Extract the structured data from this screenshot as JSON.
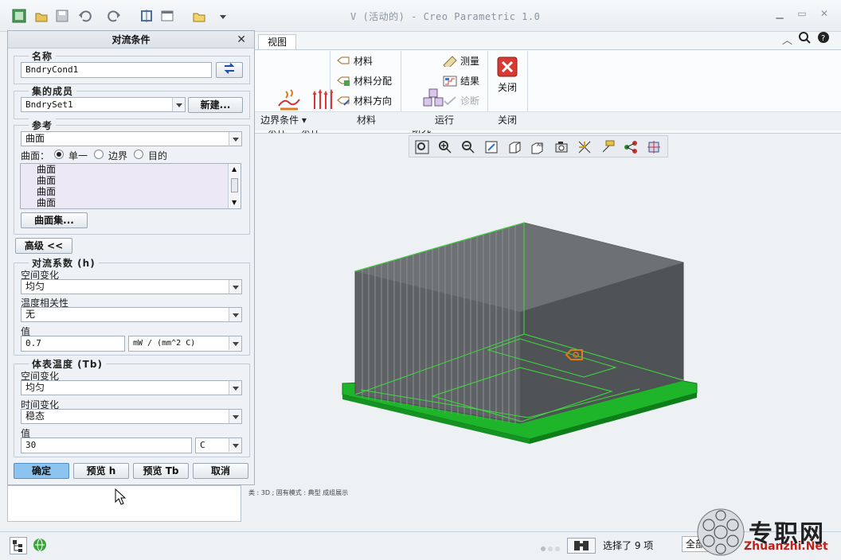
{
  "window": {
    "title": "V (活动的) - Creo Parametric 1.0"
  },
  "ribbon": {
    "tab_view": "视图",
    "convection_label": "对流\n条件",
    "radiation_label": "辐射\n条件",
    "material": "材料",
    "material_assign": "材料分配",
    "material_orientation": "材料方向",
    "analysis_label": "分析和\n研究",
    "measure": "测量",
    "results": "结果",
    "diagnose": "诊断",
    "close_label": "关闭",
    "group_boundary": "边界条件",
    "group_material": "材料",
    "group_run": "运行",
    "group_close": "关闭"
  },
  "dialog": {
    "title": "对流条件",
    "name_legend": "名称",
    "name_value": "BndryCond1",
    "set_legend": "集的成员",
    "set_value": "BndrySet1",
    "new_button": "新建...",
    "ref_legend": "参考",
    "ref_type": "曲面",
    "surface_label": "曲面：",
    "radio_single": "单一",
    "radio_boundary": "边界",
    "radio_target": "目的",
    "ref_items": [
      "曲面",
      "曲面",
      "曲面",
      "曲面"
    ],
    "surface_set_button": "曲面集...",
    "advanced_button": "高级 <<",
    "h_legend": "对流系数 (h)",
    "h_spatial_label": "空间变化",
    "h_spatial_value": "均匀",
    "h_temp_label": "温度相关性",
    "h_temp_value": "无",
    "h_value_label": "值",
    "h_value": "0.7",
    "h_unit": "mW / (mm^2 C)",
    "tb_legend": "体表温度 (Tb)",
    "tb_spatial_label": "空间变化",
    "tb_spatial_value": "均匀",
    "tb_time_label": "时间变化",
    "tb_time_value": "稳态",
    "tb_value_label": "值",
    "tb_value": "30",
    "tb_unit": "C",
    "ok_button": "确定",
    "preview_h_button": "预览 h",
    "preview_tb_button": "预览 Tb",
    "cancel_button": "取消"
  },
  "graphics": {
    "model_status": "类 : 3D ; 固有模式 : 典型 成组展示"
  },
  "status": {
    "selection": "选择了 9 项",
    "filter": "全部"
  },
  "watermark": {
    "cn": "专职网",
    "en": "Zhuanzhi.Net"
  },
  "colors": {
    "heatsink": "#5f6265",
    "base_green": "#1fb52b",
    "edge_green": "#3ddc3d",
    "ok_button": "#8cc4ef",
    "convection_icon": "#e07b1c"
  }
}
